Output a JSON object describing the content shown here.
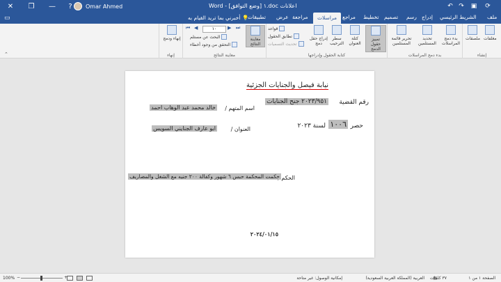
{
  "titlebar": {
    "user_name": "Omar Ahmed",
    "doc_title": "اعلانات doc.١ [وضع التوافق] - Word",
    "help_glyph": "?"
  },
  "tabs": [
    "ملف",
    "الشريط الرئيسي",
    "إدراج",
    "رسم",
    "تصميم",
    "تخطيط",
    "مراجع",
    "مراسلات",
    "مراجعة",
    "عرض",
    "تطبيقات"
  ],
  "tell_me": "أخبرني بما تريد القيام به",
  "ribbon": {
    "groups": {
      "create": "إنشاء",
      "start": "بدء دمج المراسلات",
      "fields": "كتابة الحقول وإدراجها",
      "preview": "معاينة النتائج",
      "finish": "إنهاء"
    },
    "buttons": {
      "envelopes": "مغلفات",
      "labels": "ملصقات",
      "start_merge": "بدء دمج المراسلات",
      "select_recipients": "تحديد المستلمين",
      "edit_list": "تحرير قائمة المستلمين",
      "highlight_fields": "تمييز حقول الدمج",
      "address_block": "كتلة العنوان",
      "greeting_line": "سطر الترحيب",
      "insert_field": "إدراج حقل دمج",
      "rules": "قواعد",
      "match_fields": "تطابق الحقول",
      "update_labels": "تحديث التسميات",
      "preview_results": "معاينة النتائج",
      "find_recipient": "البحث عن مستلم",
      "check_errors": "التحقق من وجود أخطاء",
      "finish_merge": "إنهاء ودمج"
    },
    "record_value": "١٠"
  },
  "document": {
    "heading": "نيابة فيصل والجنايات الجزئية",
    "case_label": "رقم القضية",
    "case_value": "٢٠٢٣/٩٥١ جنح الجنايات",
    "accused_label": "اسم المتهم /",
    "accused_value": "خالد محمد عبد الوهاب احمد",
    "hasr_label": "حصر",
    "hasr_value": "١٠٠٦",
    "hasr_year": "لسنة ٢٠٢٣",
    "address_label": "العنوان /",
    "address_value": "ابو عارف الجنايني السويس",
    "verdict_label": "الحكم /",
    "verdict_value": "حكمت المحكمة حبس ٦ شهور وكفالة ٢٠٠ جنيه مع الشغل والمصاريف",
    "date": "٢٠٢٤/٠١/١٥"
  },
  "status": {
    "page": "الصفحة ١ من ١",
    "words": "٣٧ كلمات",
    "language": "العربية (المملكة العربية السعودية)",
    "accessibility": "إمكانية الوصول: غير متاحة",
    "zoom": "100%"
  }
}
